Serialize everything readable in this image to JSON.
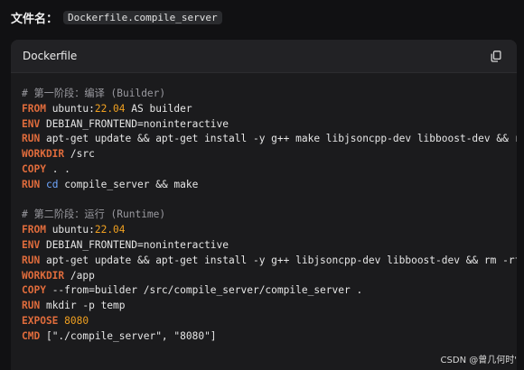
{
  "file_header": {
    "label": "文件名：",
    "file_name": "Dockerfile.compile_server"
  },
  "code_block": {
    "language_label": "Dockerfile",
    "copy_icon": "copy-icon",
    "colors": {
      "keyword": "#e06c3c",
      "number": "#f0a020",
      "comment": "#9a9aa0",
      "builtin": "#6fa7ff",
      "text": "#e6e6e6"
    },
    "lines": [
      [
        {
          "t": "comment",
          "v": "# 第一阶段：编译 (Builder)"
        }
      ],
      [
        {
          "t": "keyword",
          "v": "FROM"
        },
        {
          "t": "text",
          "v": " ubuntu:"
        },
        {
          "t": "number",
          "v": "22.04"
        },
        {
          "t": "text",
          "v": " AS builder"
        }
      ],
      [
        {
          "t": "keyword",
          "v": "ENV"
        },
        {
          "t": "text",
          "v": " DEBIAN_FRONTEND=noninteractive"
        }
      ],
      [
        {
          "t": "keyword",
          "v": "RUN"
        },
        {
          "t": "text",
          "v": " apt-get update && apt-get install -y g++ make libjsoncpp-dev libboost-dev && rm -rf /va"
        }
      ],
      [
        {
          "t": "keyword",
          "v": "WORKDIR"
        },
        {
          "t": "text",
          "v": " /src"
        }
      ],
      [
        {
          "t": "keyword",
          "v": "COPY"
        },
        {
          "t": "text",
          "v": " . ."
        }
      ],
      [
        {
          "t": "keyword",
          "v": "RUN"
        },
        {
          "t": "text",
          "v": " "
        },
        {
          "t": "builtin",
          "v": "cd"
        },
        {
          "t": "text",
          "v": " compile_server && make"
        }
      ],
      [],
      [
        {
          "t": "comment",
          "v": "# 第二阶段：运行 (Runtime)"
        }
      ],
      [
        {
          "t": "keyword",
          "v": "FROM"
        },
        {
          "t": "text",
          "v": " ubuntu:"
        },
        {
          "t": "number",
          "v": "22.04"
        }
      ],
      [
        {
          "t": "keyword",
          "v": "ENV"
        },
        {
          "t": "text",
          "v": " DEBIAN_FRONTEND=noninteractive"
        }
      ],
      [
        {
          "t": "keyword",
          "v": "RUN"
        },
        {
          "t": "text",
          "v": " apt-get update && apt-get install -y g++ libjsoncpp-dev libboost-dev && rm -rf /var/lib"
        }
      ],
      [
        {
          "t": "keyword",
          "v": "WORKDIR"
        },
        {
          "t": "text",
          "v": " /app"
        }
      ],
      [
        {
          "t": "keyword",
          "v": "COPY"
        },
        {
          "t": "text",
          "v": " --from=builder /src/compile_server/compile_server ."
        }
      ],
      [
        {
          "t": "keyword",
          "v": "RUN"
        },
        {
          "t": "text",
          "v": " mkdir -p temp"
        }
      ],
      [
        {
          "t": "keyword",
          "v": "EXPOSE"
        },
        {
          "t": "text",
          "v": " "
        },
        {
          "t": "number",
          "v": "8080"
        }
      ],
      [
        {
          "t": "keyword",
          "v": "CMD"
        },
        {
          "t": "text",
          "v": " [\"./compile_server\", \"8080\"]"
        }
      ]
    ]
  },
  "watermark": "CSDN @曾几何时'"
}
